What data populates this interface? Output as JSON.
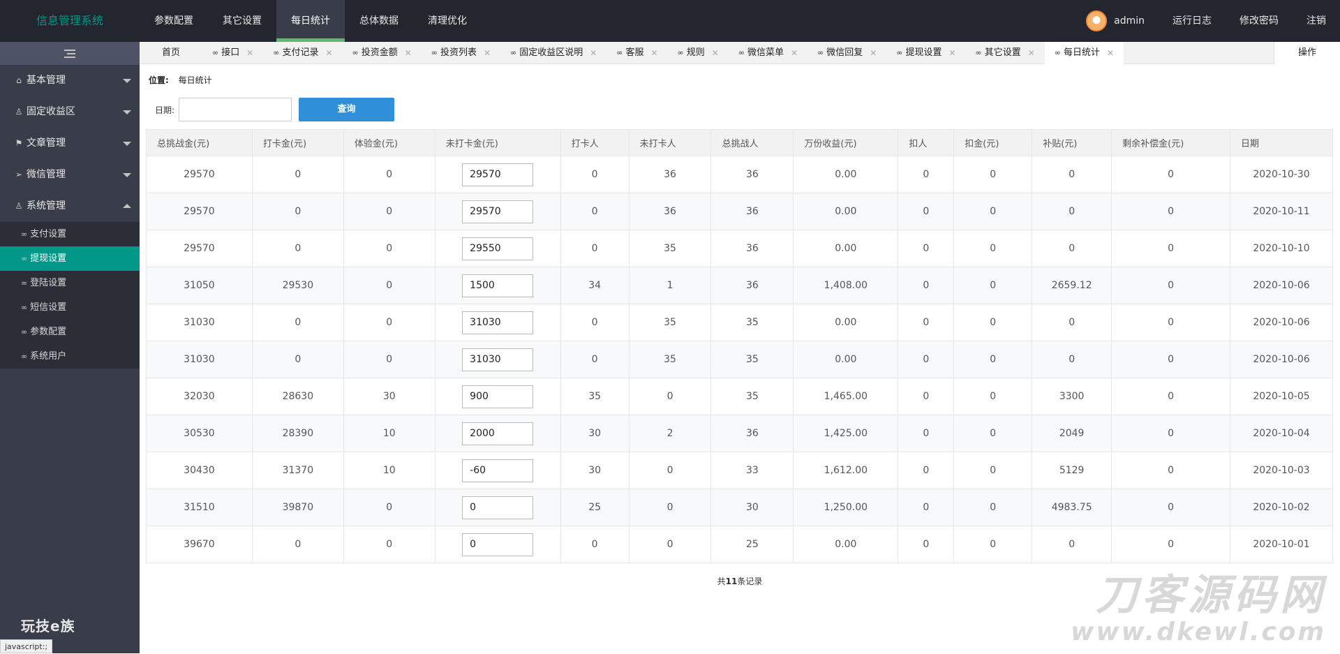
{
  "brand": "信息管理系统",
  "topnav": [
    "参数配置",
    "其它设置",
    "每日统计",
    "总体数据",
    "清理优化"
  ],
  "topnav_active": 2,
  "user": "admin",
  "toplinks": [
    "运行日志",
    "修改密码",
    "注销"
  ],
  "sidebar": {
    "groups": [
      {
        "label": "基本管理",
        "icon": "home-icon"
      },
      {
        "label": "固定收益区",
        "icon": "user-icon"
      },
      {
        "label": "文章管理",
        "icon": "flag-icon"
      },
      {
        "label": "微信管理",
        "icon": "send-icon"
      },
      {
        "label": "系统管理",
        "icon": "user-icon"
      }
    ],
    "subitems": [
      "支付设置",
      "提现设置",
      "登陆设置",
      "短信设置",
      "参数配置",
      "系统用户"
    ],
    "active_sub": 1,
    "logo": "玩技e族"
  },
  "tabs": [
    "首页",
    "接口",
    "支付记录",
    "投资金额",
    "投资列表",
    "固定收益区说明",
    "客服",
    "规则",
    "微信菜单",
    "微信回复",
    "提现设置",
    "其它设置",
    "每日统计"
  ],
  "tab_op": "操作",
  "location": {
    "label": "位置:",
    "value": "每日统计"
  },
  "query": {
    "date_label": "日期:",
    "button": "查询"
  },
  "table": {
    "headers": [
      "总挑战金(元)",
      "打卡金(元)",
      "体验金(元)",
      "未打卡金(元)",
      "打卡人",
      "未打卡人",
      "总挑战人",
      "万份收益(元)",
      "扣人",
      "扣金(元)",
      "补贴(元)",
      "剩余补偿金(元)",
      "日期"
    ],
    "rows": [
      [
        "29570",
        "0",
        "0",
        "29570",
        "0",
        "36",
        "36",
        "0.00",
        "0",
        "0",
        "0",
        "0",
        "2020-10-30"
      ],
      [
        "29570",
        "0",
        "0",
        "29570",
        "0",
        "36",
        "36",
        "0.00",
        "0",
        "0",
        "0",
        "0",
        "2020-10-11"
      ],
      [
        "29570",
        "0",
        "0",
        "29550",
        "0",
        "35",
        "36",
        "0.00",
        "0",
        "0",
        "0",
        "0",
        "2020-10-10"
      ],
      [
        "31050",
        "29530",
        "0",
        "1500",
        "34",
        "1",
        "36",
        "1,408.00",
        "0",
        "0",
        "2659.12",
        "0",
        "2020-10-06"
      ],
      [
        "31030",
        "0",
        "0",
        "31030",
        "0",
        "35",
        "35",
        "0.00",
        "0",
        "0",
        "0",
        "0",
        "2020-10-06"
      ],
      [
        "31030",
        "0",
        "0",
        "31030",
        "0",
        "35",
        "35",
        "0.00",
        "0",
        "0",
        "0",
        "0",
        "2020-10-06"
      ],
      [
        "32030",
        "28630",
        "30",
        "900",
        "35",
        "0",
        "35",
        "1,465.00",
        "0",
        "0",
        "3300",
        "0",
        "2020-10-05"
      ],
      [
        "30530",
        "28390",
        "10",
        "2000",
        "30",
        "2",
        "36",
        "1,425.00",
        "0",
        "0",
        "2049",
        "0",
        "2020-10-04"
      ],
      [
        "30430",
        "31370",
        "10",
        "-60",
        "30",
        "0",
        "33",
        "1,612.00",
        "0",
        "0",
        "5129",
        "0",
        "2020-10-03"
      ],
      [
        "31510",
        "39870",
        "0",
        "0",
        "25",
        "0",
        "30",
        "1,250.00",
        "0",
        "0",
        "4983.75",
        "0",
        "2020-10-02"
      ],
      [
        "39670",
        "0",
        "0",
        "0",
        "0",
        "0",
        "25",
        "0.00",
        "0",
        "0",
        "0",
        "0",
        "2020-10-01"
      ]
    ]
  },
  "pager": {
    "prefix": "共",
    "count": "11",
    "suffix": "条记录"
  },
  "watermark": {
    "line1": "刀客源码网",
    "line2": "www.dkewl.com"
  },
  "statusbar": "javascript:;"
}
